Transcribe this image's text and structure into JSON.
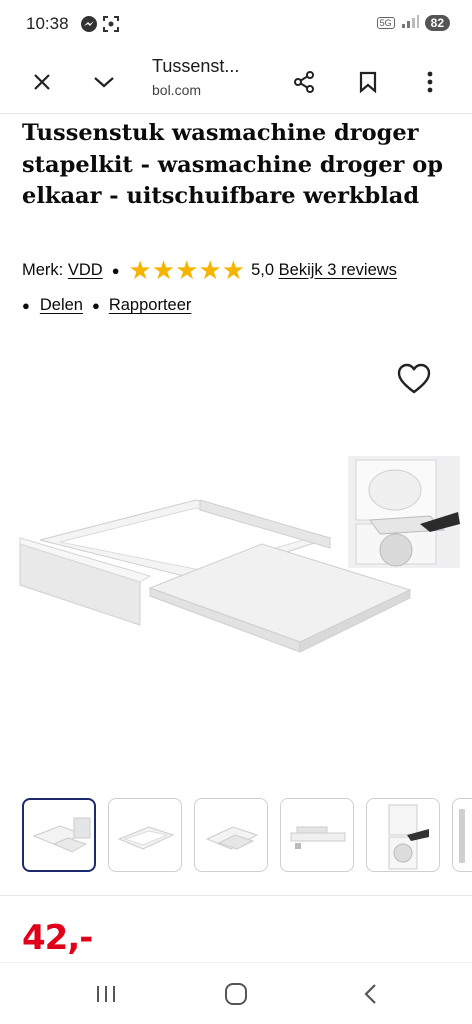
{
  "status_bar": {
    "time": "10:38",
    "network": "5G",
    "battery": "82"
  },
  "browser": {
    "page_title": "Tussenst...",
    "url": "bol.com"
  },
  "product": {
    "title": "Tussenstuk wasmachine droger stapelkit - wasmachine droger op elkaar - uitschuifbare werkblad",
    "brand_label": "Merk:",
    "brand": "VDD",
    "rating_stars": 5,
    "rating": "5,0",
    "reviews_link": "Bekijk 3 reviews",
    "share_link": "Delen",
    "report_link": "Rapporteer",
    "price": "42,-"
  },
  "colors": {
    "star": "#f5b400",
    "price": "#e0001a",
    "active_thumb": "#1a2a6c"
  },
  "icons": {
    "close": "close-icon",
    "expand": "chevron-down-icon",
    "share": "share-icon",
    "bookmark": "bookmark-icon",
    "menu": "more-vertical-icon",
    "wishlist": "heart-icon"
  }
}
